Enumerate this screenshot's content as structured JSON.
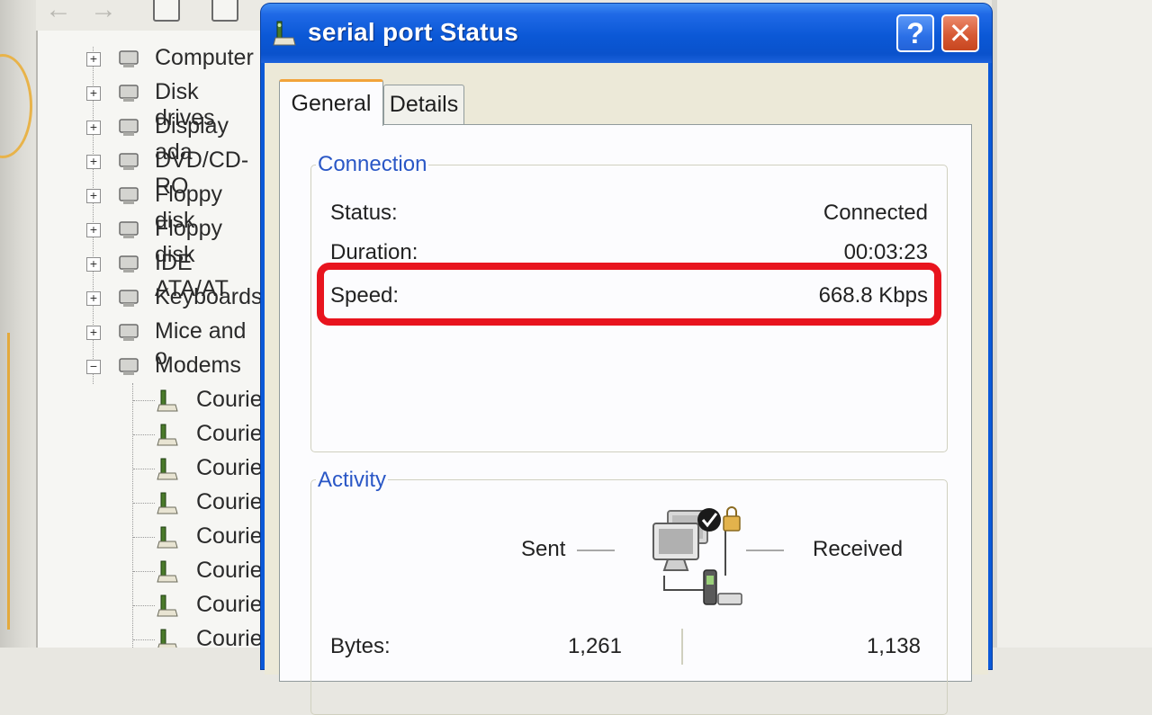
{
  "device_tree": {
    "items": [
      {
        "label": "Computer",
        "icon": "computer-icon",
        "expander": "+"
      },
      {
        "label": "Disk drives",
        "icon": "disk-drive-icon",
        "expander": "+"
      },
      {
        "label": "Display ada",
        "icon": "display-adapter-icon",
        "expander": "+"
      },
      {
        "label": "DVD/CD-RO",
        "icon": "cd-drive-icon",
        "expander": "+"
      },
      {
        "label": "Floppy disk",
        "icon": "floppy-controller-icon",
        "expander": "+"
      },
      {
        "label": "Floppy disk",
        "icon": "floppy-drive-icon",
        "expander": "+"
      },
      {
        "label": "IDE ATA/AT",
        "icon": "ide-controller-icon",
        "expander": "+"
      },
      {
        "label": "Keyboards",
        "icon": "keyboard-icon",
        "expander": "+"
      },
      {
        "label": "Mice and o",
        "icon": "mouse-icon",
        "expander": "+"
      },
      {
        "label": "Modems",
        "icon": "modem-icon",
        "expander": "−"
      }
    ],
    "modem_children": [
      "Courie",
      "Courie",
      "Courie",
      "Courie",
      "Courie",
      "Courie",
      "Courie",
      "Courie"
    ]
  },
  "dialog": {
    "title": "serial port Status",
    "help_label": "?",
    "close_label": "✕",
    "tabs": [
      {
        "label": "General",
        "active": true
      },
      {
        "label": "Details",
        "active": false
      }
    ],
    "connection": {
      "title": "Connection",
      "status_label": "Status:",
      "status_value": "Connected",
      "duration_label": "Duration:",
      "duration_value": "00:03:23",
      "speed_label": "Speed:",
      "speed_value": "668.8 Kbps"
    },
    "activity": {
      "title": "Activity",
      "sent_label": "Sent",
      "received_label": "Received",
      "bytes_label": "Bytes:",
      "bytes_sent": "1,261",
      "bytes_received": "1,138"
    }
  },
  "colors": {
    "title_bar": "#0b58d6",
    "highlight_box": "#e8141e",
    "group_title": "#2a57c6",
    "active_tab_accent": "#f2a33a"
  }
}
